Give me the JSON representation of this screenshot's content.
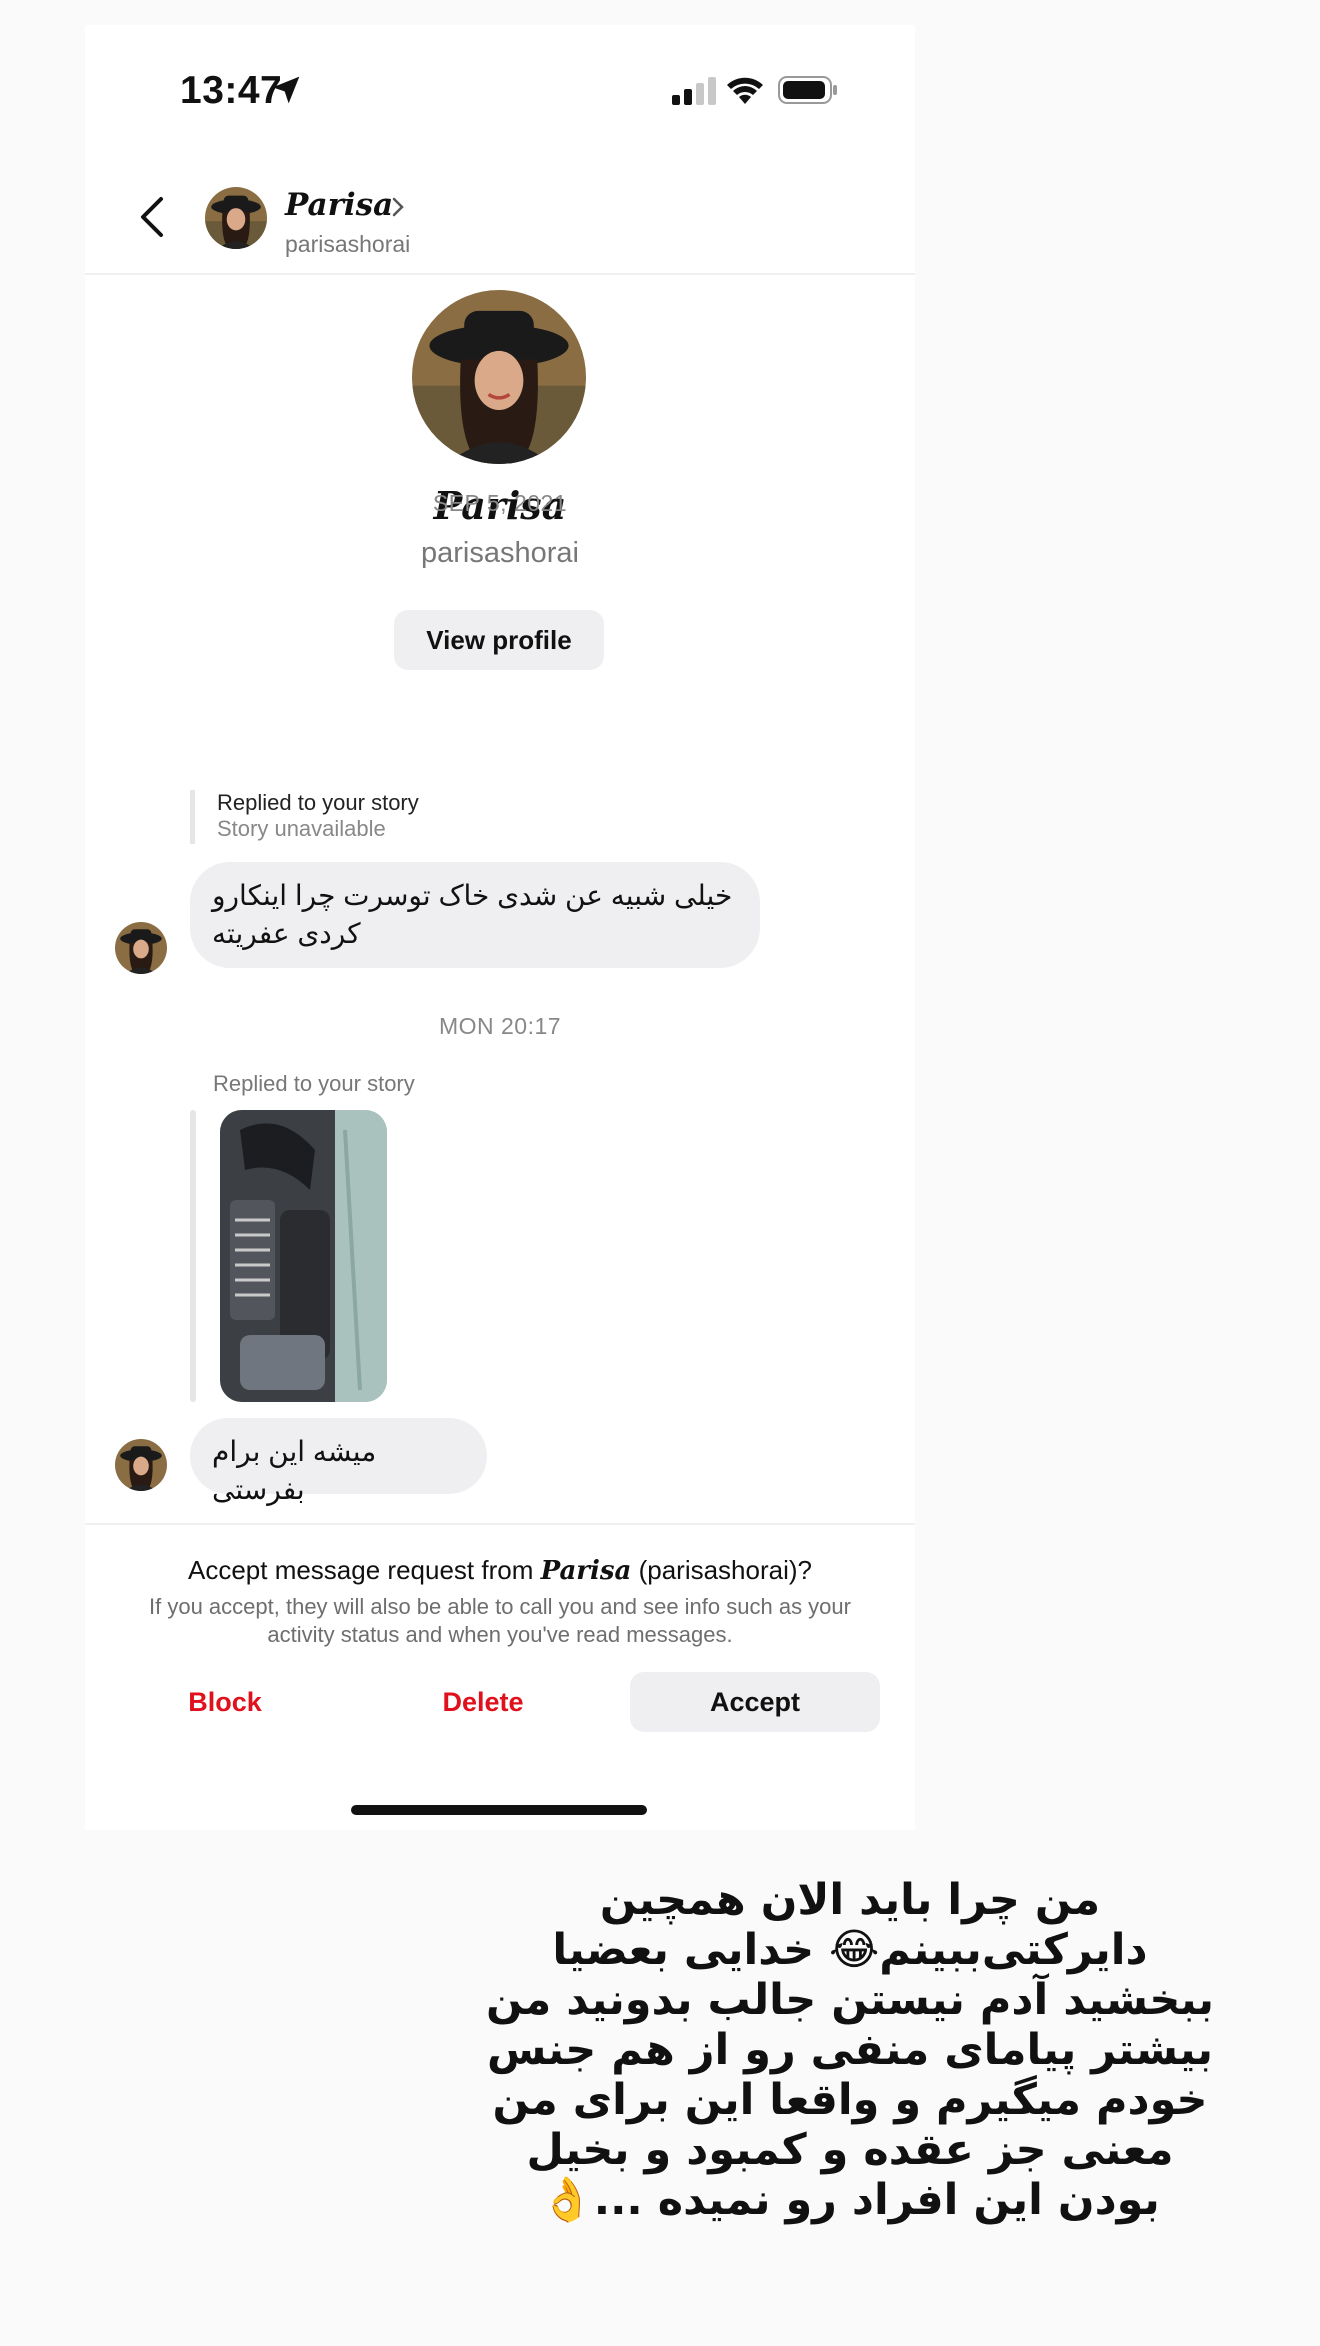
{
  "status_bar": {
    "time": "13:47"
  },
  "header": {
    "name": "Parisa",
    "username": "parisashorai"
  },
  "profile": {
    "name": "Parisa",
    "username": "parisashorai",
    "view_profile_label": "View profile"
  },
  "thread": {
    "date_1": "SEP 5, 2021",
    "reply_1": {
      "title": "Replied to your story",
      "subtitle": "Story unavailable"
    },
    "message_1": "خیلی شبیه عن شدی خاک توسرت چرا اینکارو کردی عفریته",
    "date_2": "MON 20:17",
    "reply_2_label": "Replied to your story",
    "message_2": "میشه این برام بفرستی"
  },
  "request": {
    "title_prefix": "Accept message request from ",
    "title_name": "Parisa",
    "title_suffix": " (parisashorai)?",
    "description": "If you accept, they will also be able to call you and see info such as your activity status and when you've read messages.",
    "block_label": "Block",
    "delete_label": "Delete",
    "accept_label": "Accept"
  },
  "caption": "من چرا باید الان همچین دایرکتی‌ببینم😂 خدایی بعضیا ببخشید آدم نیستن جالب بدونید من بیشتر پیامای منفی رو از هم جنس خودم میگیرم و واقعا این برای من معنی جز عقده و کمبود و بخیل بودن این افراد رو نمیده ...👌",
  "colors": {
    "danger": "#e0101c",
    "bubble": "#efeff1",
    "muted": "#777777"
  }
}
